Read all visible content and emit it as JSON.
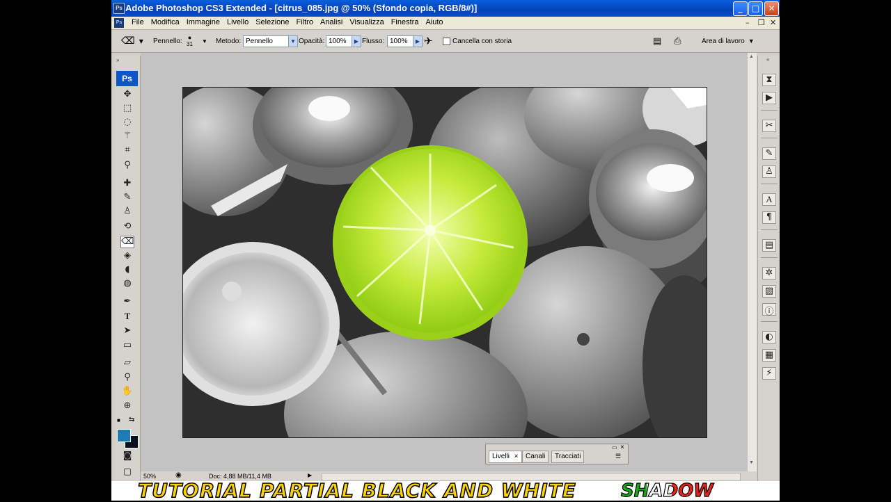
{
  "window": {
    "title": "Adobe Photoshop CS3 Extended - [citrus_085.jpg @ 50% (Sfondo copia, RGB/8#)]",
    "app_icon": "Ps",
    "controls": {
      "minimize": "_",
      "maximize": "□",
      "close": "✕"
    }
  },
  "menubar": {
    "items": [
      "File",
      "Modifica",
      "Immagine",
      "Livello",
      "Selezione",
      "Filtro",
      "Analisi",
      "Visualizza",
      "Finestra",
      "Aiuto"
    ],
    "doc_controls": {
      "minimize": "–",
      "restore": "❐",
      "close": "✕"
    }
  },
  "options": {
    "brush_label": "Pennello:",
    "brush_size": "31",
    "mode_label": "Metodo:",
    "mode_value": "Pennello",
    "opacity_label": "Opacità:",
    "opacity_value": "100%",
    "flow_label": "Flusso:",
    "flow_value": "100%",
    "erase_history_label": "Cancella con storia",
    "workspace_label": "Area di lavoro"
  },
  "toolbox": {
    "logo": "Ps",
    "active_tool": "eraser-tool",
    "foreground_color": "#1e7db5",
    "background_color": "#0c1120"
  },
  "status": {
    "zoom": "50%",
    "doc_info": "Doc: 4,88 MB/11,4 MB"
  },
  "layers_panel": {
    "tabs": [
      "Livelli",
      "Canali",
      "Tracciati"
    ],
    "active_tab": "Livelli",
    "tab_close": "×"
  },
  "banner": {
    "text": "TUTORIAL PARTIAL BLACK AND WHITE",
    "credit": "SHADOW"
  },
  "colors": {
    "lime": "#b5e61d",
    "title_bar": "#0a4cc9"
  }
}
